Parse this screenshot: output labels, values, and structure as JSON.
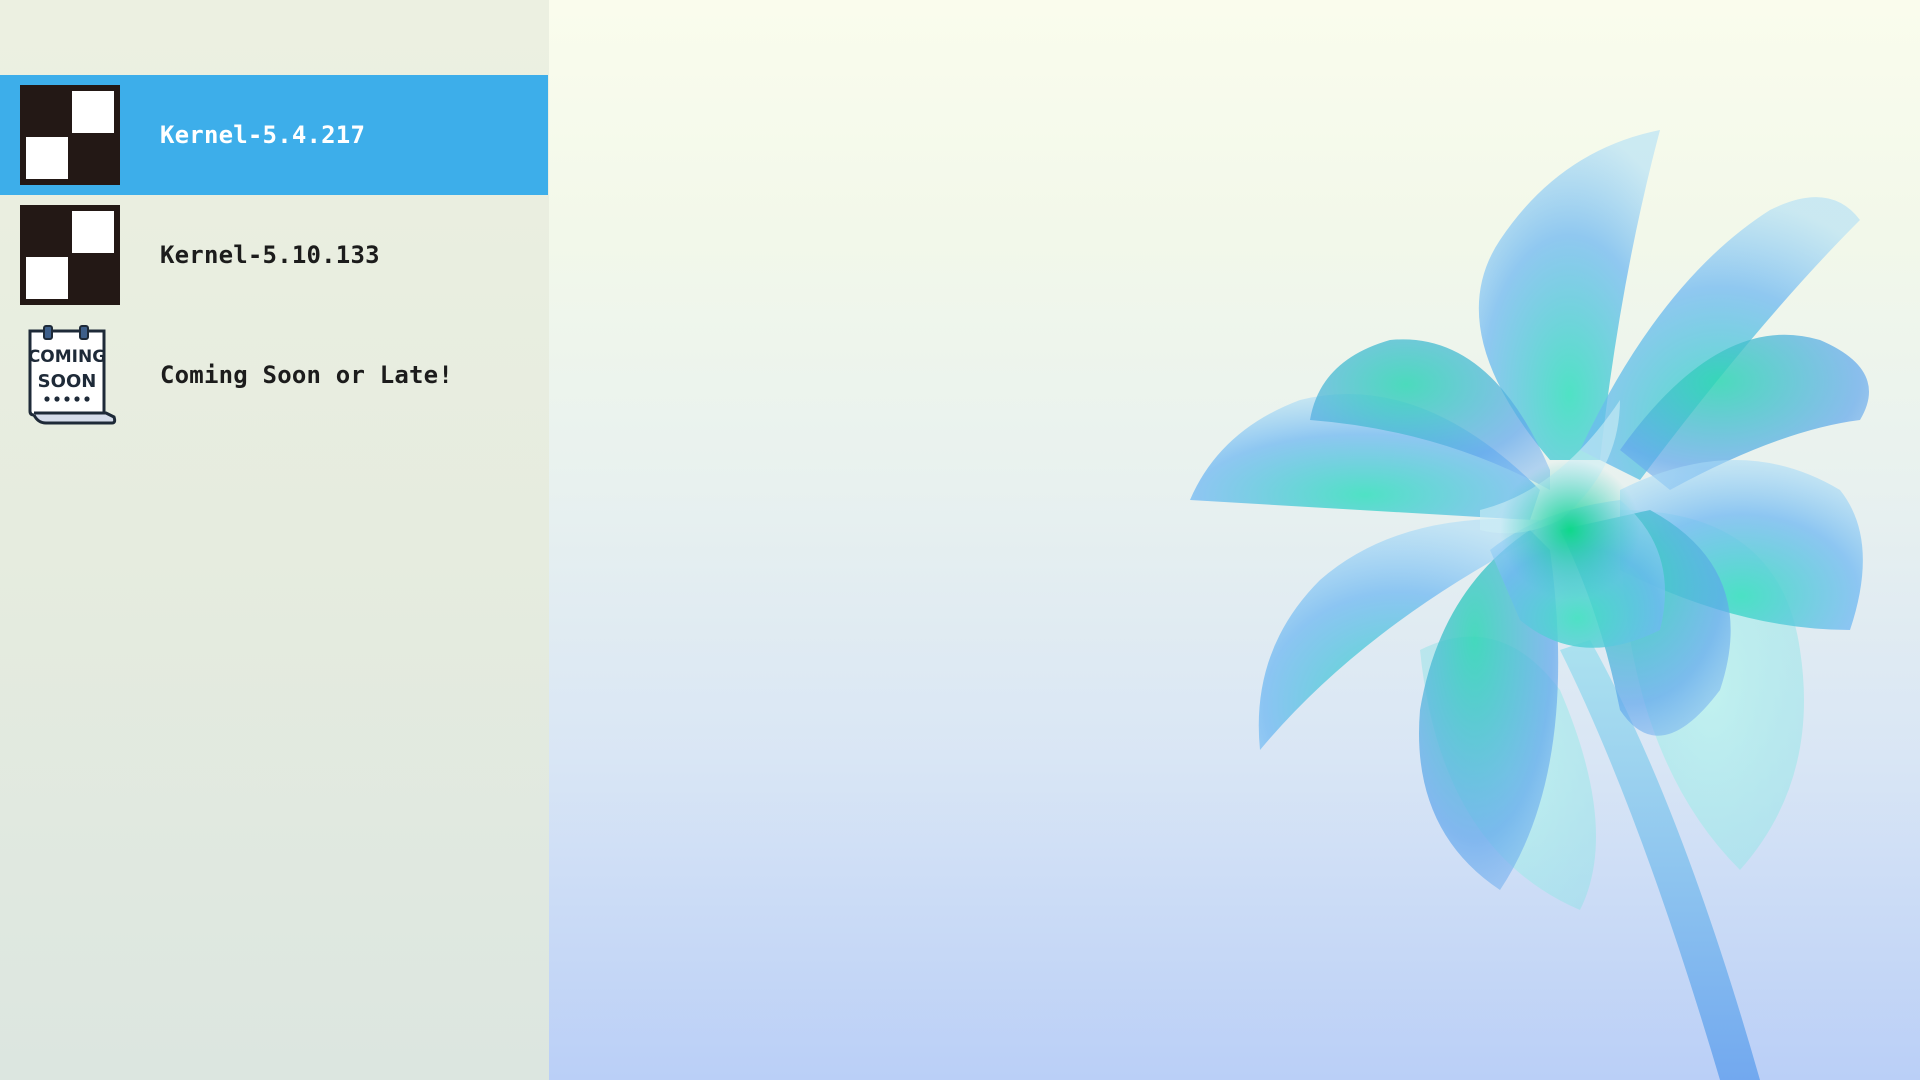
{
  "menu": {
    "items": [
      {
        "label": "Kernel-5.4.217",
        "icon": "checker-icon",
        "selected": true
      },
      {
        "label": "Kernel-5.10.133",
        "icon": "checker-icon",
        "selected": false
      },
      {
        "label": "Coming Soon or Late!",
        "icon": "coming-soon-icon",
        "selected": false
      }
    ],
    "coming_soon_icon_text": [
      "COMING",
      "SOON"
    ]
  },
  "colors": {
    "selected_background": "#3daeea",
    "sidebar_background": "#e6ecdf",
    "icon_dark": "#231815"
  }
}
